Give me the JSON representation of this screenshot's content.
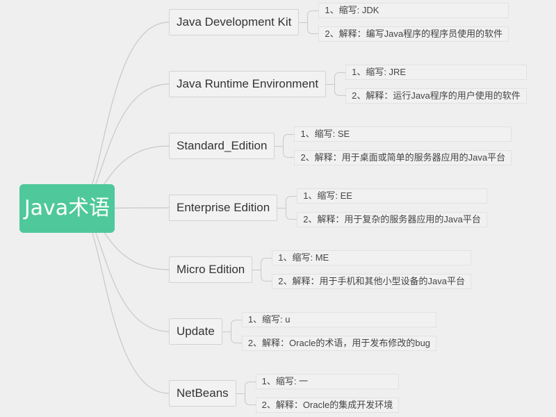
{
  "root": {
    "label": "Java术语"
  },
  "branches": [
    {
      "label": "Java Development Kit",
      "children": [
        "1、缩写: JDK",
        "2、解释：编写Java程序的程序员使用的软件"
      ]
    },
    {
      "label": "Java Runtime Environment",
      "children": [
        "1、缩写: JRE",
        "2、解释：运行Java程序的用户使用的软件"
      ]
    },
    {
      "label": "Standard_Edition",
      "children": [
        "1、缩写: SE",
        "2、解释：用于桌面或简单的服务器应用的Java平台"
      ]
    },
    {
      "label": "Enterprise Edition",
      "children": [
        "1、缩写: EE",
        "2、解释：用于复杂的服务器应用的Java平台"
      ]
    },
    {
      "label": "Micro Edition",
      "children": [
        "1、缩写: ME",
        "2、解释：用于手机和其他小型设备的Java平台"
      ]
    },
    {
      "label": "Update",
      "children": [
        "1、缩写: u",
        "2、解释：Oracle的术语，用于发布修改的bug"
      ]
    },
    {
      "label": "NetBeans",
      "children": [
        "1、缩写: 一",
        "2、解释：Oracle的集成开发环境"
      ]
    }
  ],
  "colors": {
    "background": "#efefef",
    "root_fill": "#4fc89b",
    "line": "#c8c8c8"
  }
}
